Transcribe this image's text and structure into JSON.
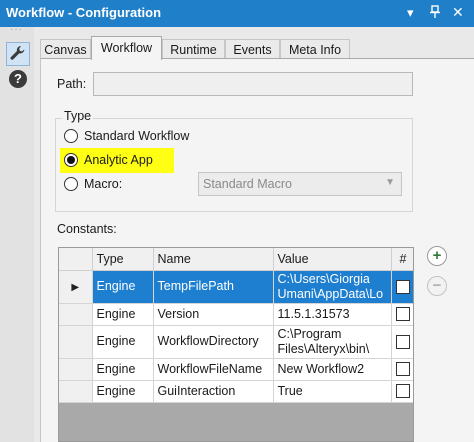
{
  "window": {
    "title": "Workflow - Configuration",
    "pin_icon": "pin-icon",
    "close_icon": "close-icon",
    "dropdown_icon": "chevron-down-icon"
  },
  "toolbar": {
    "tool_icon": "wrench-icon",
    "help_label": "?"
  },
  "tabs": [
    {
      "label": "Canvas",
      "active": false
    },
    {
      "label": "Workflow",
      "active": true
    },
    {
      "label": "Runtime",
      "active": false
    },
    {
      "label": "Events",
      "active": false
    },
    {
      "label": "Meta Info",
      "active": false
    }
  ],
  "workflow": {
    "path_label": "Path:",
    "path_value": "",
    "type_label": "Type",
    "options": {
      "standard": "Standard Workflow",
      "analytic": "Analytic App",
      "macro": "Macro:"
    },
    "selected": "analytic",
    "macro_select_value": "Standard Macro",
    "constants_label": "Constants:"
  },
  "constants": {
    "columns": [
      "Type",
      "Name",
      "Value",
      "#"
    ],
    "rows": [
      {
        "type": "Engine",
        "name": "TempFilePath",
        "value_lines": [
          "C:\\Users\\Giorgia",
          "Umani\\AppData\\Lo"
        ],
        "selected": true
      },
      {
        "type": "Engine",
        "name": "Version",
        "value_lines": [
          "11.5.1.31573"
        ],
        "selected": false
      },
      {
        "type": "Engine",
        "name": "WorkflowDirectory",
        "value_lines": [
          "C:\\Program",
          "Files\\Alteryx\\bin\\"
        ],
        "selected": false
      },
      {
        "type": "Engine",
        "name": "WorkflowFileName",
        "value_lines": [
          "New Workflow2"
        ],
        "selected": false
      },
      {
        "type": "Engine",
        "name": "GuiInteraction",
        "value_lines": [
          "True"
        ],
        "selected": false
      }
    ]
  },
  "buttons": {
    "add": "+",
    "remove": "−"
  },
  "colors": {
    "titlebar": "#1f7fc9",
    "selection": "#1e7fd0",
    "highlight": "#ffff14"
  }
}
